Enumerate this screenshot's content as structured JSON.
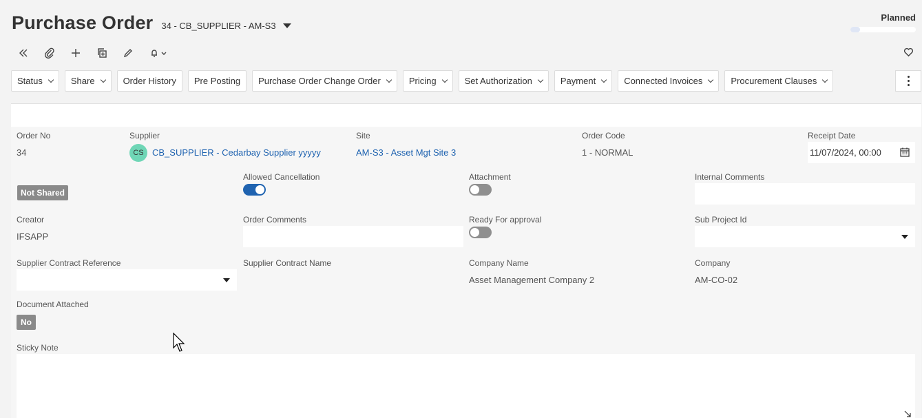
{
  "header": {
    "title": "Purchase Order",
    "record": "34 - CB_SUPPLIER - AM-S3",
    "status": "Planned",
    "status_progress": 0.15
  },
  "toolbar": {
    "icons": [
      "collapse-icon",
      "paperclip-icon",
      "plus-icon",
      "duplicate-icon",
      "pencil-icon",
      "bell-icon"
    ]
  },
  "commands": [
    {
      "label": "Status",
      "dropdown": true
    },
    {
      "label": "Share",
      "dropdown": true
    },
    {
      "label": "Order History",
      "dropdown": false
    },
    {
      "label": "Pre Posting",
      "dropdown": false
    },
    {
      "label": "Purchase Order Change Order",
      "dropdown": true
    },
    {
      "label": "Pricing",
      "dropdown": true
    },
    {
      "label": "Set Authorization",
      "dropdown": true
    },
    {
      "label": "Payment",
      "dropdown": true
    },
    {
      "label": "Connected Invoices",
      "dropdown": true
    },
    {
      "label": "Procurement Clauses",
      "dropdown": true
    }
  ],
  "form": {
    "order_no": {
      "label": "Order No",
      "value": "34"
    },
    "supplier": {
      "label": "Supplier",
      "initials": "CS",
      "value": "CB_SUPPLIER - Cedarbay Supplier yyyyy"
    },
    "site": {
      "label": "Site",
      "value": "AM-S3 - Asset Mgt Site 3"
    },
    "order_code": {
      "label": "Order Code",
      "value": "1 - NORMAL"
    },
    "receipt_date": {
      "label": "Receipt Date",
      "value": "11/07/2024, 00:00"
    },
    "share_status": "Not Shared",
    "allowed_cancellation": {
      "label": "Allowed Cancellation",
      "on": true
    },
    "attachment": {
      "label": "Attachment",
      "on": false
    },
    "internal_comments": {
      "label": "Internal Comments",
      "value": ""
    },
    "creator": {
      "label": "Creator",
      "value": "IFSAPP"
    },
    "order_comments": {
      "label": "Order Comments",
      "value": ""
    },
    "ready_for_approval": {
      "label": "Ready For approval",
      "on": false
    },
    "sub_project_id": {
      "label": "Sub Project Id",
      "value": ""
    },
    "supplier_contract_reference": {
      "label": "Supplier Contract Reference",
      "value": ""
    },
    "supplier_contract_name": {
      "label": "Supplier Contract Name",
      "value": ""
    },
    "company_name": {
      "label": "Company Name",
      "value": "Asset Management Company 2"
    },
    "company": {
      "label": "Company",
      "value": "AM-CO-02"
    },
    "document_attached": {
      "label": "Document Attached",
      "value": "No"
    },
    "sticky_note": {
      "label": "Sticky Note",
      "value": ""
    }
  }
}
